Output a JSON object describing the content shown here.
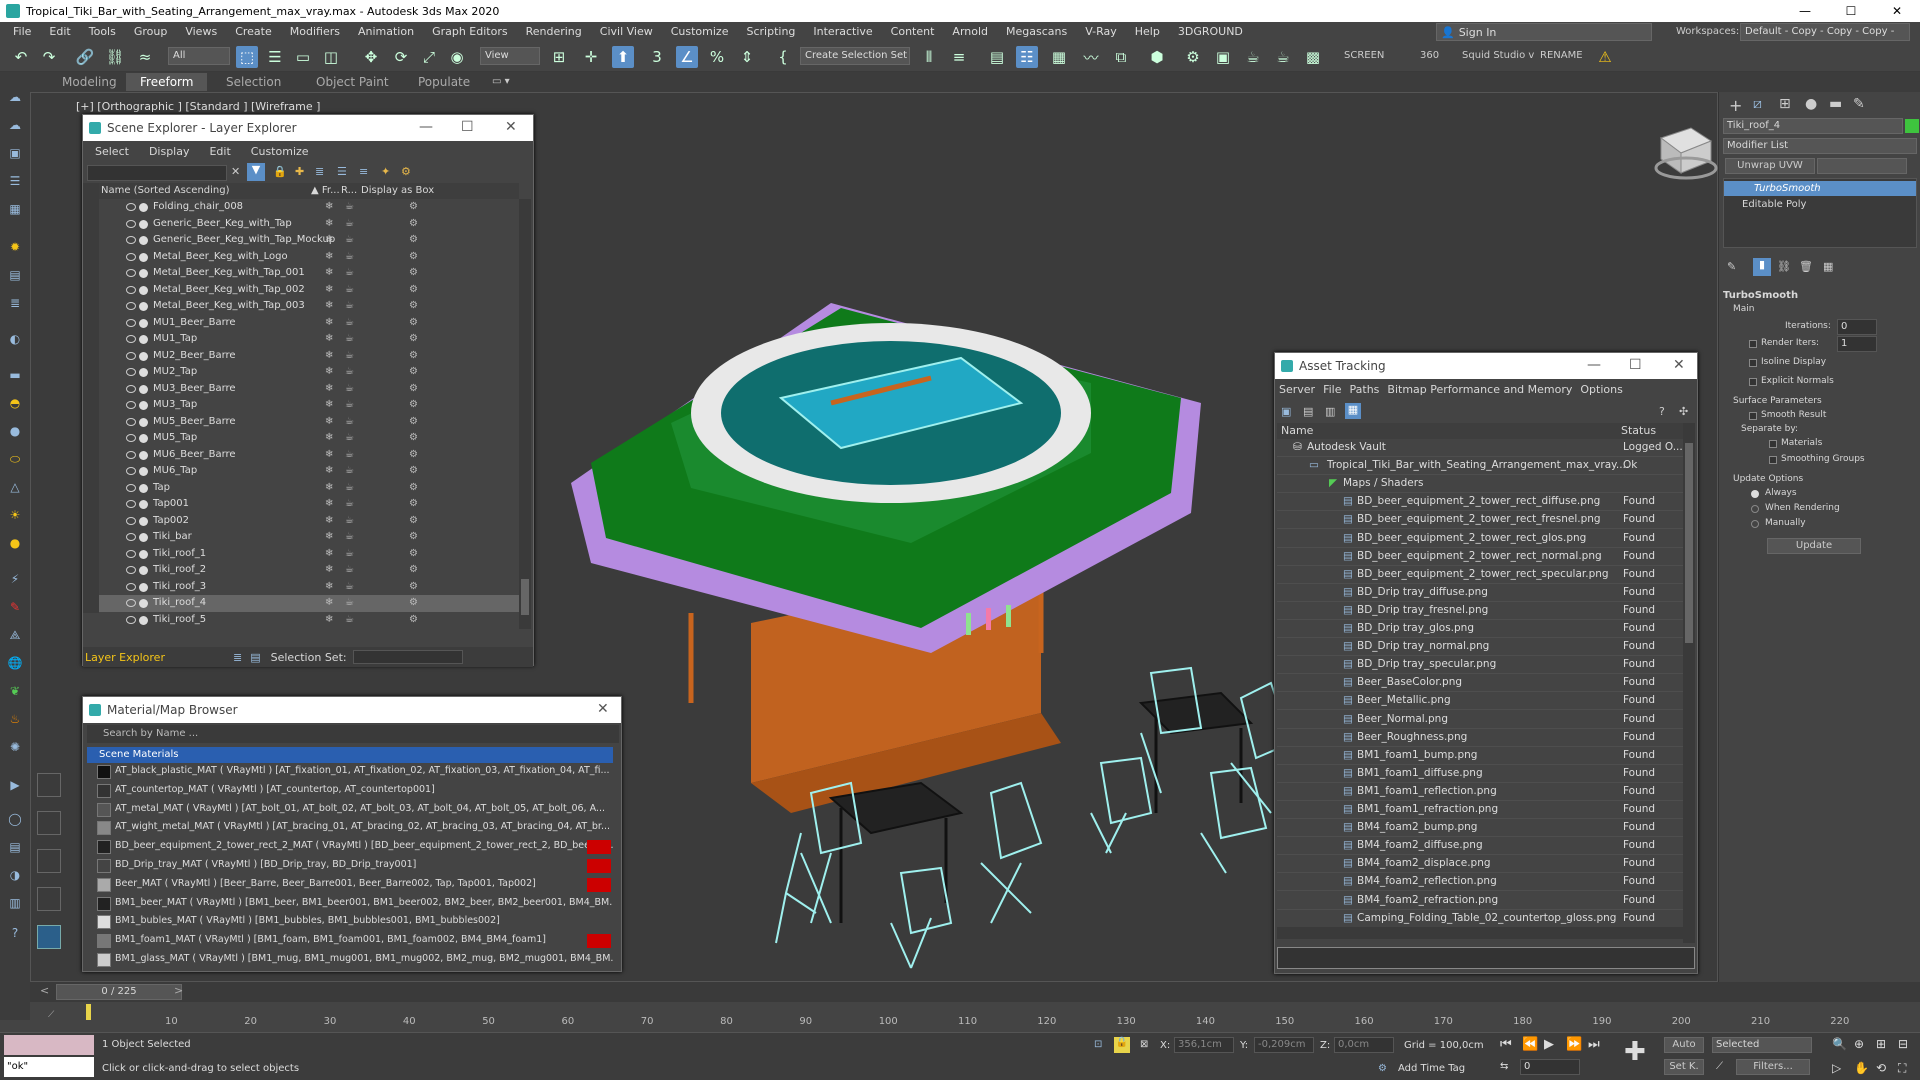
{
  "window": {
    "title": "Tropical_Tiki_Bar_with_Seating_Arrangement_max_vray.max - Autodesk 3ds Max 2020",
    "minimize": "—",
    "maximize": "☐",
    "close": "✕"
  },
  "menu": [
    "File",
    "Edit",
    "Tools",
    "Group",
    "Views",
    "Create",
    "Modifiers",
    "Animation",
    "Graph Editors",
    "Rendering",
    "Civil View",
    "Customize",
    "Scripting",
    "Interactive",
    "Content",
    "Arnold",
    "Megascans",
    "V-Ray",
    "Help",
    "3DGROUND"
  ],
  "signin": "Sign In",
  "workspaces_label": "Workspaces:",
  "workspaces_value": "Default - Copy - Copy - Copy - Copy",
  "toolbar": {
    "filter_value": "All",
    "view_value": "View",
    "selection_set_value": "Create Selection Set",
    "screen_label": "SCREEN",
    "angle_value": "360",
    "studio_label": "Squid Studio v",
    "rename_label": "RENAME"
  },
  "ribbon_tabs": [
    "Modeling",
    "Freeform",
    "Selection",
    "Object Paint",
    "Populate"
  ],
  "viewport_label": "[+] [Orthographic ] [Standard ] [Wireframe ]",
  "scene_explorer": {
    "title": "Scene Explorer - Layer Explorer",
    "menu": [
      "Select",
      "Display",
      "Edit",
      "Customize"
    ],
    "col_name": "Name (Sorted Ascending)",
    "col_fr": "▲ Fr...",
    "col_r": "R...",
    "col_box": "Display as Box",
    "rows": [
      "Folding_chair_008",
      "Generic_Beer_Keg_with_Tap",
      "Generic_Beer_Keg_with_Tap_Mockup",
      "Metal_Beer_Keg_with_Logo",
      "Metal_Beer_Keg_with_Tap_001",
      "Metal_Beer_Keg_with_Tap_002",
      "Metal_Beer_Keg_with_Tap_003",
      "MU1_Beer_Barre",
      "MU1_Tap",
      "MU2_Beer_Barre",
      "MU2_Tap",
      "MU3_Beer_Barre",
      "MU3_Tap",
      "MU5_Beer_Barre",
      "MU5_Tap",
      "MU6_Beer_Barre",
      "MU6_Tap",
      "Tap",
      "Tap001",
      "Tap002",
      "Tiki_bar",
      "Tiki_roof_1",
      "Tiki_roof_2",
      "Tiki_roof_3",
      "Tiki_roof_4",
      "Tiki_roof_5"
    ],
    "selected_row": "Tiki_roof_4",
    "footer_mode": "Layer Explorer",
    "selection_set_label": "Selection Set:"
  },
  "material_browser": {
    "title": "Material/Map Browser",
    "search_placeholder": "Search by Name ...",
    "group_label": "Scene Materials",
    "rows": [
      "AT_black_plastic_MAT  ( VRayMtl ) [AT_fixation_01, AT_fixation_02, AT_fixation_03, AT_fixation_04, AT_fi...",
      "AT_countertop_MAT  ( VRayMtl ) [AT_countertop, AT_countertop001]",
      "AT_metal_MAT  ( VRayMtl ) [AT_bolt_01, AT_bolt_02, AT_bolt_03, AT_bolt_04, AT_bolt_05, AT_bolt_06, A...",
      "AT_wight_metal_MAT  ( VRayMtl ) [AT_bracing_01, AT_bracing_02, AT_bracing_03, AT_bracing_04, AT_br...",
      "BD_beer_equipment_2_tower_rect_2_MAT  ( VRayMtl ) [BD_beer_equipment_2_tower_rect_2, BD_beer_e...",
      "BD_Drip_tray_MAT  ( VRayMtl ) [BD_Drip_tray, BD_Drip_tray001]",
      "Beer_MAT  ( VRayMtl ) [Beer_Barre, Beer_Barre001, Beer_Barre002, Tap, Tap001, Tap002]",
      "BM1_beer_MAT  ( VRayMtl ) [BM1_beer, BM1_beer001, BM1_beer002, BM2_beer, BM2_beer001, BM4_BM...",
      "BM1_bubles_MAT  ( VRayMtl ) [BM1_bubbles, BM1_bubbles001, BM1_bubbles002]",
      "BM1_foam1_MAT  ( VRayMtl ) [BM1_foam, BM1_foam001, BM1_foam002, BM4_BM4_foam1]",
      "BM1_glass_MAT  ( VRayMtl ) [BM1_mug, BM1_mug001, BM1_mug002, BM2_mug, BM2_mug001, BM4_BM..."
    ]
  },
  "asset_tracking": {
    "title": "Asset Tracking",
    "menu": [
      "Server",
      "File",
      "Paths",
      "Bitmap Performance and Memory",
      "Options"
    ],
    "col_name": "Name",
    "col_status": "Status",
    "vault": {
      "name": "Autodesk Vault",
      "status": "Logged O..."
    },
    "file": {
      "name": "Tropical_Tiki_Bar_with_Seating_Arrangement_max_vray....",
      "status": "Ok"
    },
    "maps_label": "Maps / Shaders",
    "rows": [
      {
        "name": "BD_beer_equipment_2_tower_rect_diffuse.png",
        "status": "Found"
      },
      {
        "name": "BD_beer_equipment_2_tower_rect_fresnel.png",
        "status": "Found"
      },
      {
        "name": "BD_beer_equipment_2_tower_rect_glos.png",
        "status": "Found"
      },
      {
        "name": "BD_beer_equipment_2_tower_rect_normal.png",
        "status": "Found"
      },
      {
        "name": "BD_beer_equipment_2_tower_rect_specular.png",
        "status": "Found"
      },
      {
        "name": "BD_Drip tray_diffuse.png",
        "status": "Found"
      },
      {
        "name": "BD_Drip tray_fresnel.png",
        "status": "Found"
      },
      {
        "name": "BD_Drip tray_glos.png",
        "status": "Found"
      },
      {
        "name": "BD_Drip tray_normal.png",
        "status": "Found"
      },
      {
        "name": "BD_Drip tray_specular.png",
        "status": "Found"
      },
      {
        "name": "Beer_BaseColor.png",
        "status": "Found"
      },
      {
        "name": "Beer_Metallic.png",
        "status": "Found"
      },
      {
        "name": "Beer_Normal.png",
        "status": "Found"
      },
      {
        "name": "Beer_Roughness.png",
        "status": "Found"
      },
      {
        "name": "BM1_foam1_bump.png",
        "status": "Found"
      },
      {
        "name": "BM1_foam1_diffuse.png",
        "status": "Found"
      },
      {
        "name": "BM1_foam1_reflection.png",
        "status": "Found"
      },
      {
        "name": "BM1_foam1_refraction.png",
        "status": "Found"
      },
      {
        "name": "BM4_foam2_bump.png",
        "status": "Found"
      },
      {
        "name": "BM4_foam2_diffuse.png",
        "status": "Found"
      },
      {
        "name": "BM4_foam2_displace.png",
        "status": "Found"
      },
      {
        "name": "BM4_foam2_reflection.png",
        "status": "Found"
      },
      {
        "name": "BM4_foam2_refraction.png",
        "status": "Found"
      },
      {
        "name": "Camping_Folding_Table_02_countertop_gloss.png",
        "status": "Found"
      }
    ]
  },
  "command_panel": {
    "object_name": "Tiki_roof_4",
    "object_color": "#3ec43e",
    "modifier_list": "Modifier List",
    "unwrap_button": "Unwrap UVW",
    "stack": [
      "TurboSmooth",
      "Editable Poly"
    ],
    "rollout_title": "TurboSmooth",
    "main_label": "Main",
    "iterations_label": "Iterations:",
    "iterations_value": "0",
    "render_iters_label": "Render Iters:",
    "render_iters_value": "1",
    "isoline": "Isoline Display",
    "explicit": "Explicit Normals",
    "surface_params": "Surface Parameters",
    "smooth_result": "Smooth Result",
    "separate_by": "Separate by:",
    "materials": "Materials",
    "smoothing_groups": "Smoothing Groups",
    "update_options": "Update Options",
    "always": "Always",
    "when_rendering": "When Rendering",
    "manually": "Manually",
    "update_button": "Update"
  },
  "timeline": {
    "frame_readout": "0 / 225",
    "ticks": [
      "10",
      "20",
      "30",
      "40",
      "50",
      "60",
      "70",
      "80",
      "90",
      "100",
      "110",
      "120",
      "130",
      "140",
      "150",
      "160",
      "170",
      "180",
      "190",
      "200",
      "210",
      "220"
    ]
  },
  "status": {
    "script_text": "\"ok\"",
    "objects_selected": "1 Object Selected",
    "prompt": "Click or click-and-drag to select objects",
    "x_label": "X:",
    "x_value": "356,1cm",
    "y_label": "Y:",
    "y_value": "-0,209cm",
    "z_label": "Z:",
    "z_value": "0,0cm",
    "grid": "Grid = 100,0cm",
    "add_time_tag": "Add Time Tag",
    "auto": "Auto",
    "selected": "Selected",
    "setk": "Set K.",
    "filters": "Filters...",
    "frame_value": "0"
  },
  "colors": {
    "accent_blue": "#5b8fc7",
    "selection_blue": "#2a5fb0",
    "wood": "#c8641e",
    "roof_green": "#0f7a1a",
    "roof_purple": "#b58be0",
    "chairs": "#9ff0ee"
  }
}
